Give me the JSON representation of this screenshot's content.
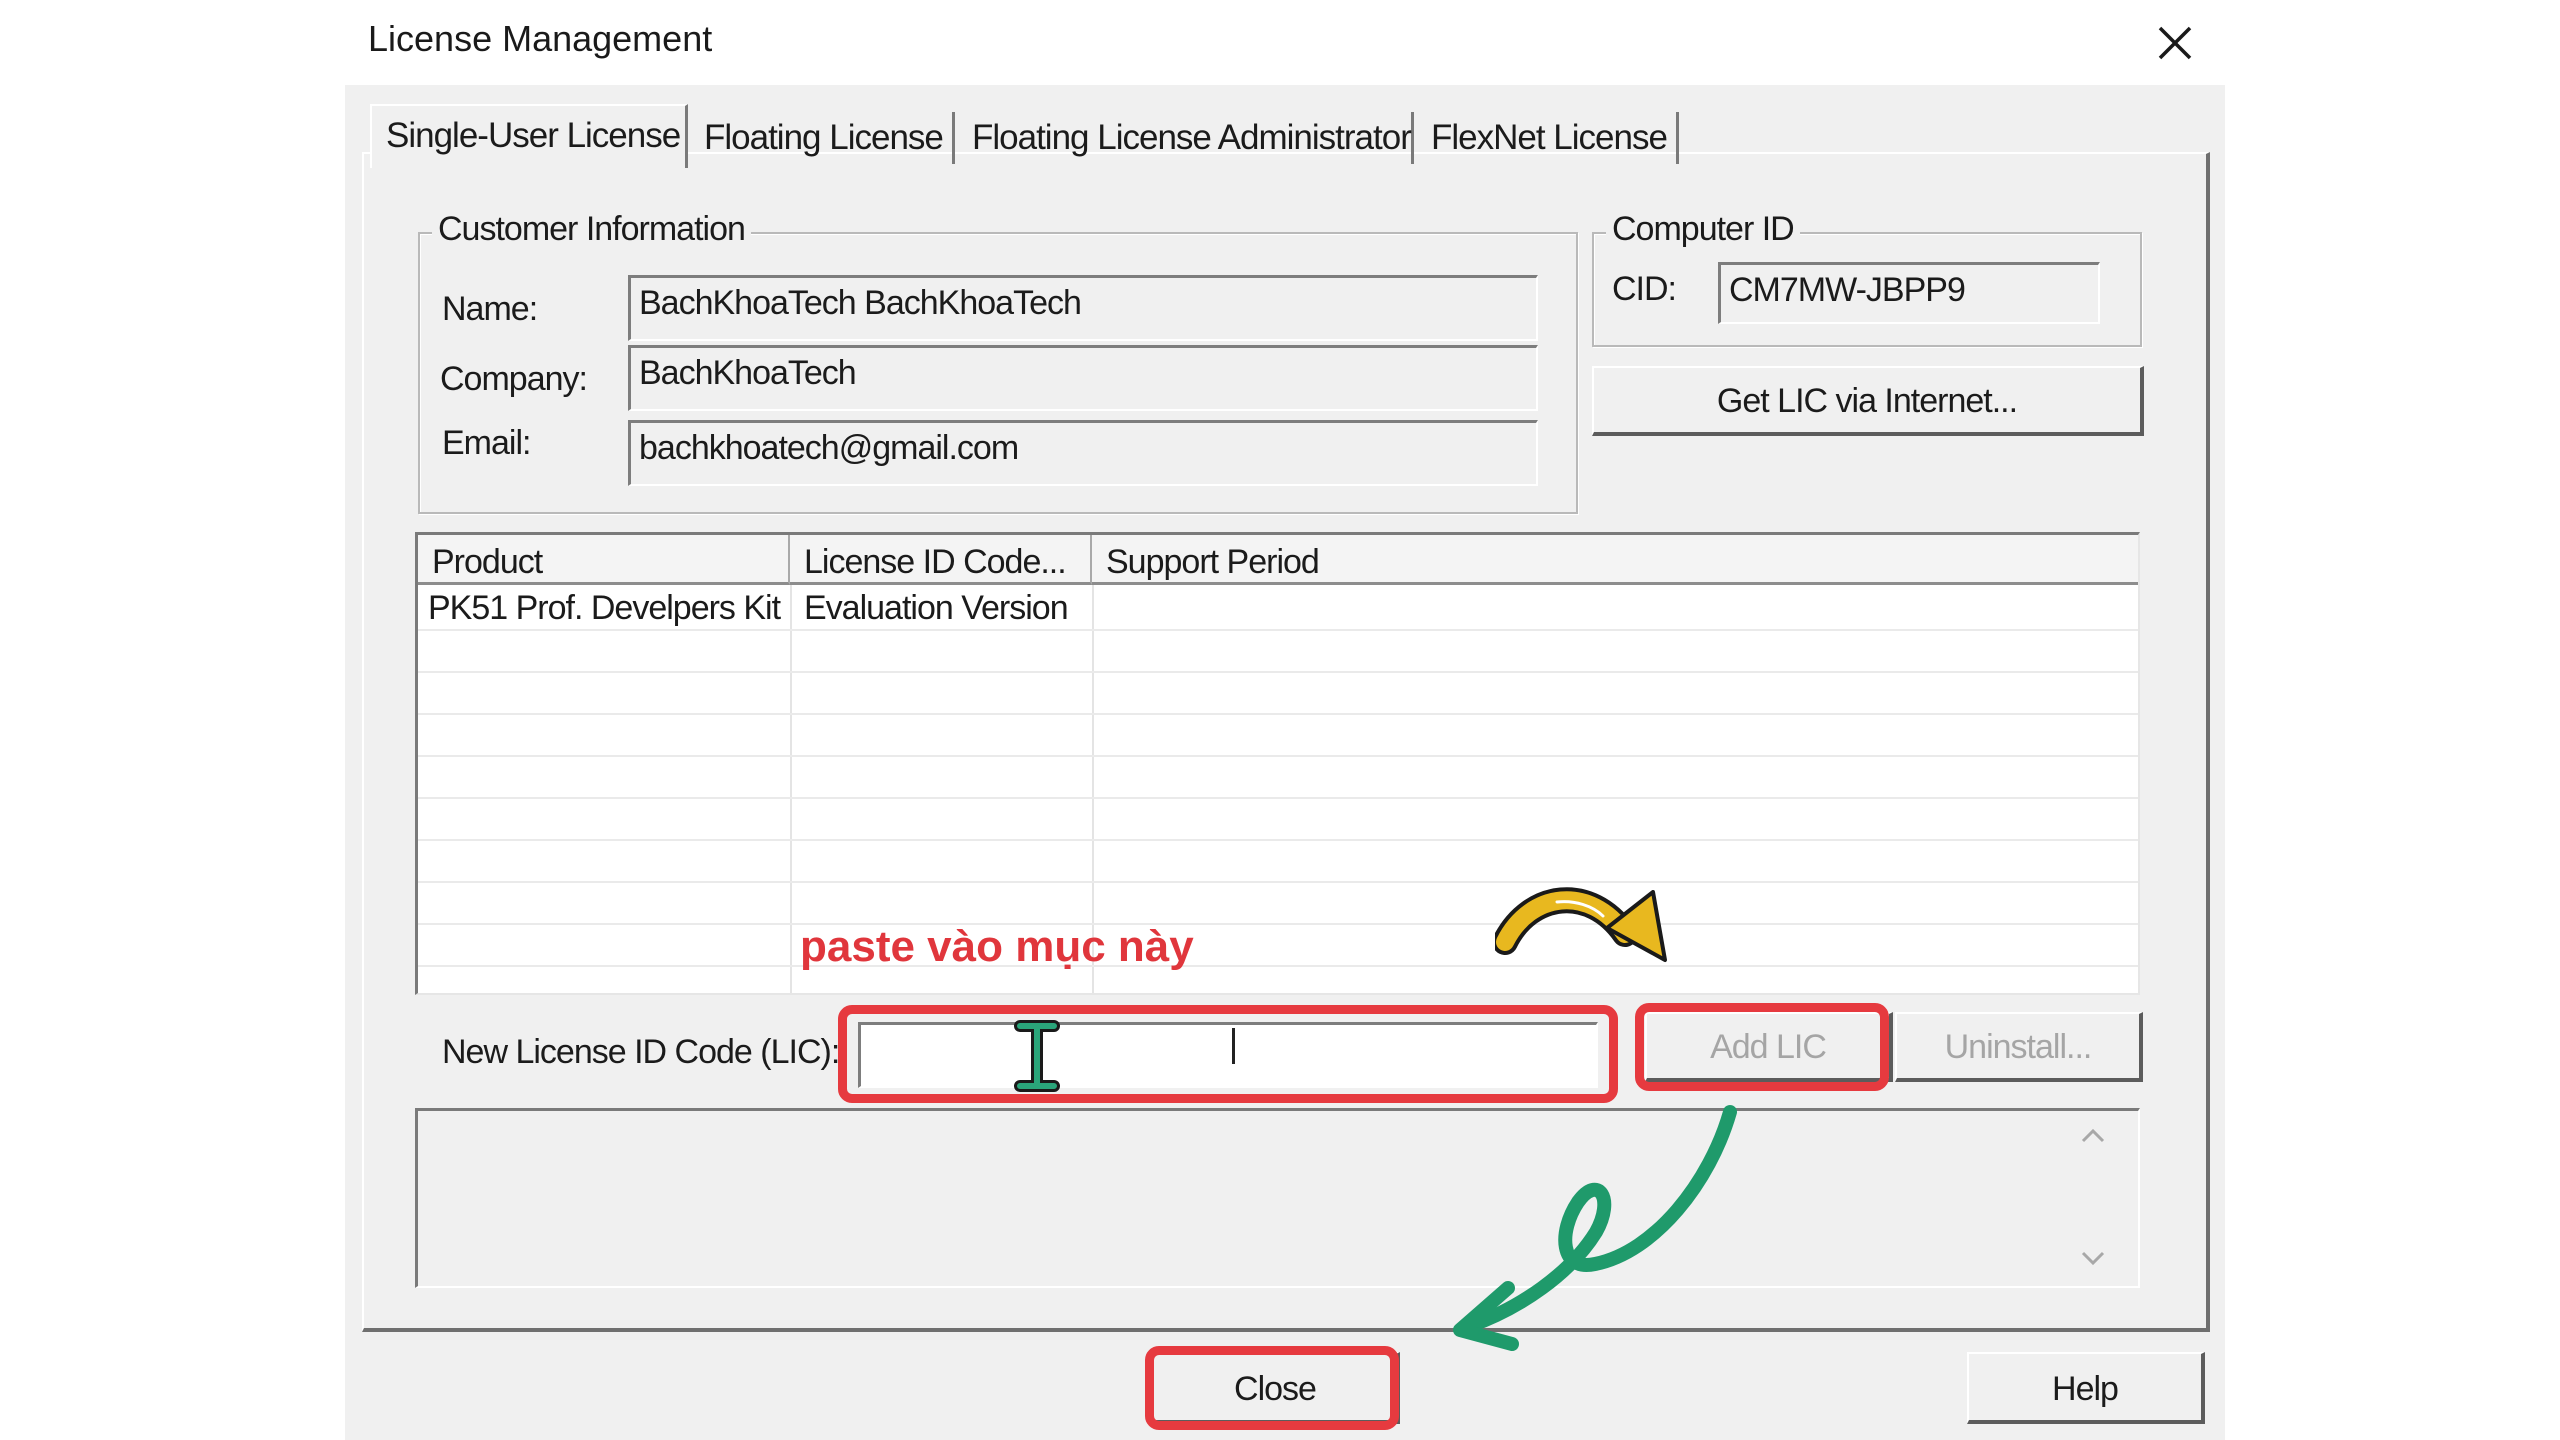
{
  "window": {
    "title": "License Management",
    "close_icon": "close-icon"
  },
  "tabs": [
    {
      "label": "Single-User License",
      "active": true
    },
    {
      "label": "Floating License",
      "active": false
    },
    {
      "label": "Floating License Administrator",
      "active": false
    },
    {
      "label": "FlexNet License",
      "active": false
    }
  ],
  "customer": {
    "group_label": "Customer Information",
    "name_label": "Name:",
    "name_value": "BachKhoaTech BachKhoaTech",
    "company_label": "Company:",
    "company_value": "BachKhoaTech",
    "email_label": "Email:",
    "email_value": "bachkhoatech@gmail.com"
  },
  "computer": {
    "group_label": "Computer ID",
    "cid_label": "CID:",
    "cid_value": "CM7MW-JBPP9",
    "get_lic_button": "Get LIC via Internet..."
  },
  "license_table": {
    "columns": [
      "Product",
      "License ID Code...",
      "Support Period"
    ],
    "rows": [
      [
        "PK51 Prof. Develpers Kit",
        "Evaluation Version",
        ""
      ]
    ]
  },
  "new_lic": {
    "label": "New License ID Code (LIC):",
    "value": "",
    "add_button": "Add LIC",
    "uninstall_button": "Uninstall..."
  },
  "footer": {
    "close_button": "Close",
    "help_button": "Help"
  },
  "annotation": {
    "text": "paste vào mục này",
    "highlight_color": "#e63a3f",
    "arrow_yellow": "#e8b81f",
    "arrow_green": "#1f9a6b"
  }
}
